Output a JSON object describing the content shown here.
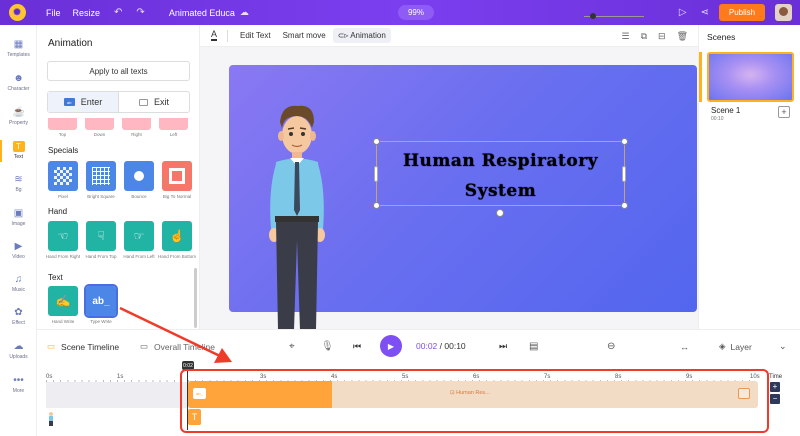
{
  "topbar": {
    "file": "File",
    "resize": "Resize",
    "title": "Animated Educa",
    "zoom": "99%",
    "publish": "Publish"
  },
  "rail": [
    {
      "label": "Templates",
      "icon": "templates-icon"
    },
    {
      "label": "Character",
      "icon": "character-icon"
    },
    {
      "label": "Property",
      "icon": "property-icon"
    },
    {
      "label": "Text",
      "icon": "text-icon"
    },
    {
      "label": "Bg",
      "icon": "background-icon"
    },
    {
      "label": "Image",
      "icon": "image-icon"
    },
    {
      "label": "Video",
      "icon": "video-icon"
    },
    {
      "label": "Music",
      "icon": "music-icon"
    },
    {
      "label": "Effect",
      "icon": "effect-icon"
    },
    {
      "label": "Uploads",
      "icon": "uploads-icon"
    },
    {
      "label": "More",
      "icon": "more-icon"
    }
  ],
  "panel": {
    "title": "Animation",
    "apply_all": "Apply to all texts",
    "tab_enter": "Enter",
    "tab_exit": "Exit",
    "partial_labels": [
      "Top",
      "Down",
      "Right",
      "Left"
    ],
    "specials_title": "Specials",
    "specials": [
      "Pixel",
      "Bright Square",
      "Bounce",
      "Big To Normal"
    ],
    "hand_title": "Hand",
    "hand": [
      "Hand From Right",
      "Hand From Top",
      "Hand From Left",
      "Hand From Bottom"
    ],
    "text_title": "Text",
    "text": [
      "Hand Write",
      "Type Write"
    ],
    "type_write_glyph": "ab_"
  },
  "canvas_toolbar": {
    "font_color": "A",
    "edit_text": "Edit Text",
    "smart_move": "Smart move",
    "animation": "Animation"
  },
  "slide": {
    "title_line1": "Human Respiratory",
    "title_line2": "System"
  },
  "scenes": {
    "title": "Scenes",
    "items": [
      {
        "label": "Scene 1",
        "duration": "00:10"
      }
    ],
    "add": "+"
  },
  "timeline": {
    "scene_timeline": "Scene Timeline",
    "overall_timeline": "Overall Timeline",
    "current_time": "00:02",
    "total_time": "/ 00:10",
    "layer": "Layer",
    "ruler": [
      "0s",
      "1s",
      "2s",
      "3s",
      "4s",
      "5s",
      "6s",
      "7s",
      "8s",
      "9s",
      "10s"
    ],
    "time_label": "Time",
    "track_text": "Human Res...",
    "track_icon_text": "ab_",
    "text_badge": "T",
    "playhead": "0:02"
  },
  "colors": {
    "brand": "#7b3ff0",
    "publish": "#ff7a1a",
    "accent": "#ffb21c",
    "annotation": "#ef3b2a"
  }
}
